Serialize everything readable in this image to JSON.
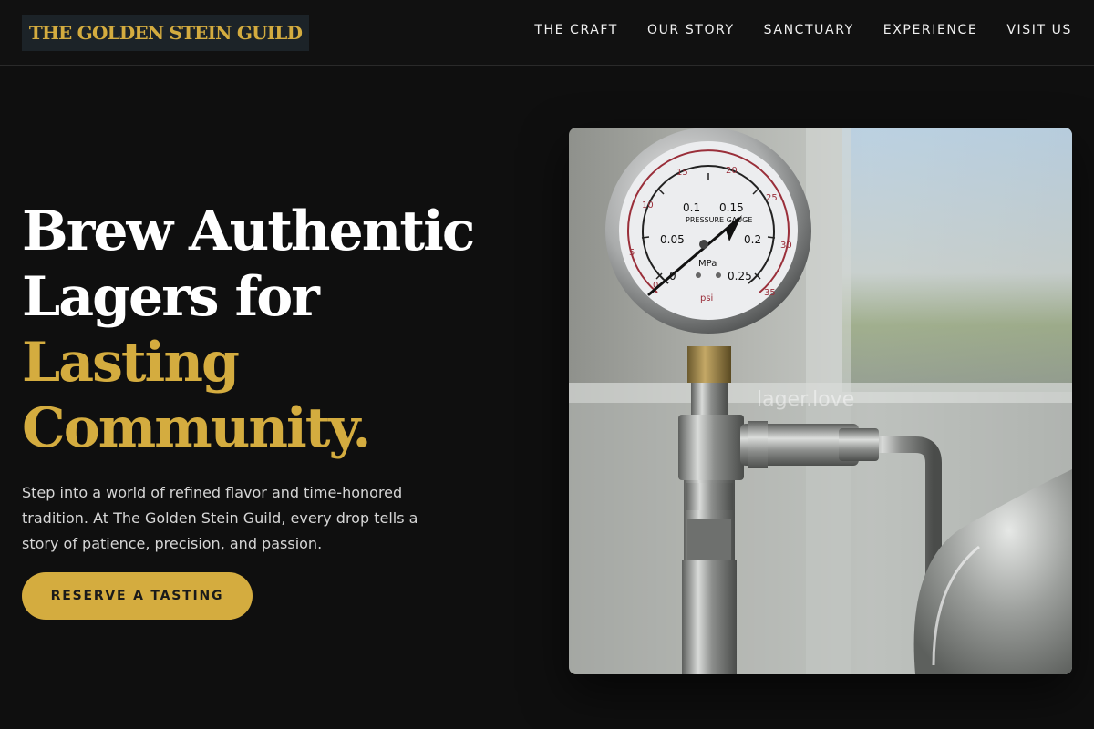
{
  "brand": {
    "name": "THE GOLDEN STEIN GUILD"
  },
  "nav": {
    "items": [
      {
        "label": "THE CRAFT"
      },
      {
        "label": "OUR STORY"
      },
      {
        "label": "SANCTUARY"
      },
      {
        "label": "EXPERIENCE"
      },
      {
        "label": "VISIT US"
      }
    ]
  },
  "hero": {
    "title_line1": "Brew Authentic",
    "title_line2": "Lagers for",
    "title_line3": "Lasting",
    "title_line4": "Community.",
    "description": "Step into a world of refined flavor and time-honored tradition. At The Golden Stein Guild, every drop tells a story of patience, precision, and passion.",
    "cta_label": "RESERVE A TASTING"
  },
  "photo": {
    "watermark": "lager.love",
    "gauge": {
      "unit_mpa": "MPa",
      "unit_psi": "psi",
      "brand_text": "PRESSURE GAUGE",
      "mpa_ticks": [
        "0",
        "0.05",
        "0.1",
        "0.15",
        "0.2",
        "0.25"
      ],
      "psi_ticks": [
        "0",
        "5",
        "10",
        "15",
        "20",
        "25",
        "30",
        "35"
      ]
    }
  },
  "colors": {
    "accent": "#d4ac3f",
    "background": "#0f0f0f",
    "logo_background": "#1c2328"
  }
}
